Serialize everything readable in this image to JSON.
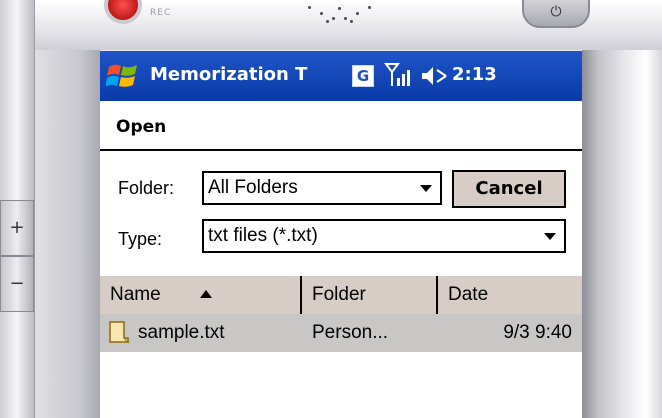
{
  "device": {
    "rec_label": "REC"
  },
  "taskbar": {
    "start_icon": "windows-flag-icon",
    "app_title": "Memorization T",
    "g_icon_label": "G",
    "signal_icon": "signal-icon",
    "volume_icon": "volume-muted-icon",
    "clock": "2:13"
  },
  "dialog": {
    "title": "Open",
    "folder_label": "Folder:",
    "folder_value": "All Folders",
    "type_label": "Type:",
    "type_value": "txt files (*.txt)",
    "cancel_label": "Cancel"
  },
  "file_list": {
    "columns": [
      "Name",
      "Folder",
      "Date"
    ],
    "sort_indicator": "sort-ascending-icon",
    "rows": [
      {
        "name": "sample.txt",
        "folder": "Person...",
        "date": "9/3 9:40"
      }
    ]
  },
  "colors": {
    "taskbar_blue": "#1c4fc0",
    "header_tan": "#d8cdc6",
    "selected_row": "#c9c6c6"
  }
}
